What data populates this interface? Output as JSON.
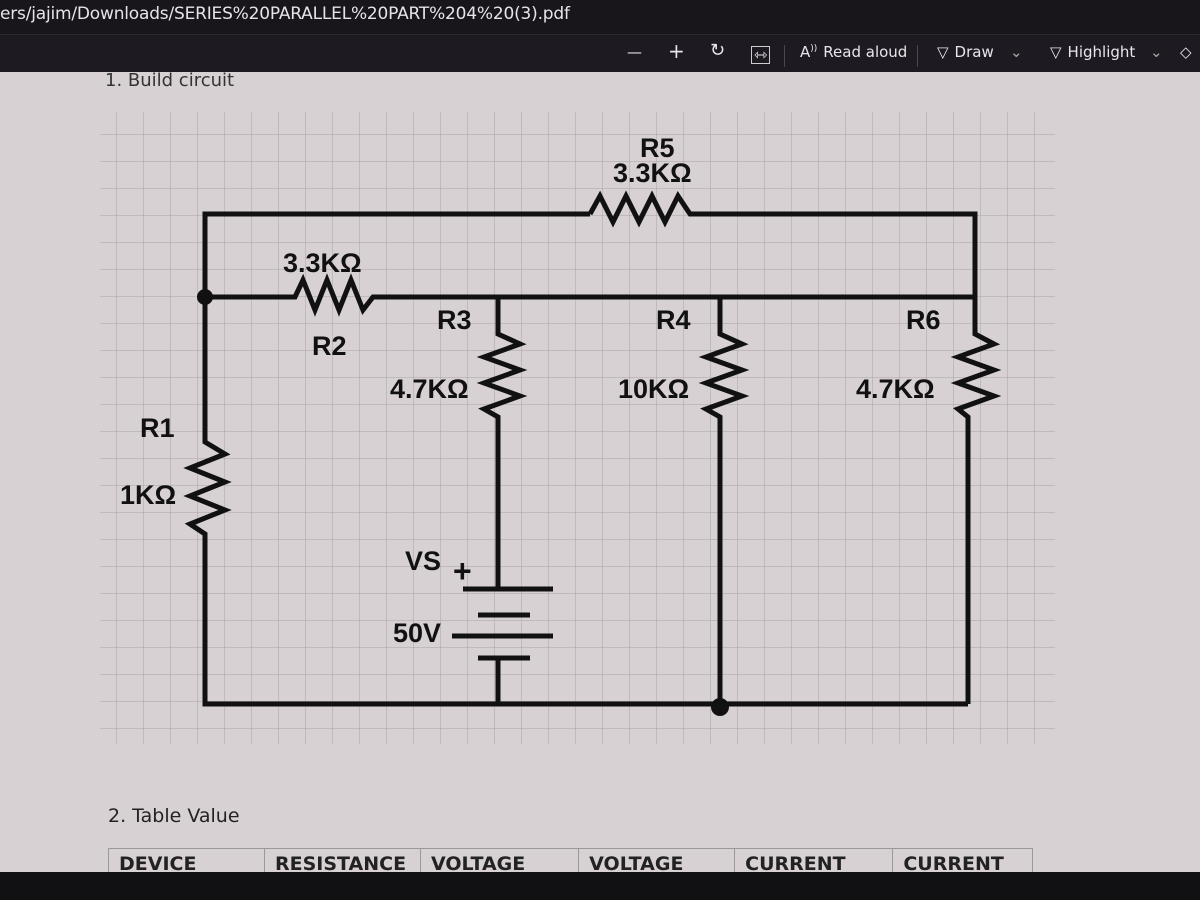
{
  "window": {
    "file_path": "ers/jajim/Downloads/SERIES%20PARALLEL%20PART%204%20(3).pdf"
  },
  "toolbar": {
    "zoom_out": "—",
    "zoom_in": "+",
    "rotate": "↻",
    "fit": "⇿",
    "read_aloud_label": "Read aloud",
    "draw_label": "Draw",
    "highlight_label": "Highlight",
    "chevron": "⌄",
    "erase": "◇"
  },
  "document": {
    "section1_heading": "1. Build circuit",
    "section2_heading": "2. Table Value",
    "circuit": {
      "components": [
        {
          "id": "R1",
          "value": "1KΩ"
        },
        {
          "id": "R2",
          "value": "3.3KΩ"
        },
        {
          "id": "R3",
          "value": "4.7KΩ"
        },
        {
          "id": "R4",
          "value": "10KΩ"
        },
        {
          "id": "R5",
          "value": "3.3KΩ"
        },
        {
          "id": "R6",
          "value": "4.7KΩ"
        },
        {
          "id": "VS",
          "value": "50V",
          "polarity": "+"
        }
      ]
    },
    "table": {
      "headers": [
        "DEVICE",
        "RESISTANCE",
        "VOLTAGE CALCULATED",
        "VOLTAGE MEASURED",
        "CURRENT CALCULATED",
        "CURRENT MEASURED"
      ]
    }
  }
}
